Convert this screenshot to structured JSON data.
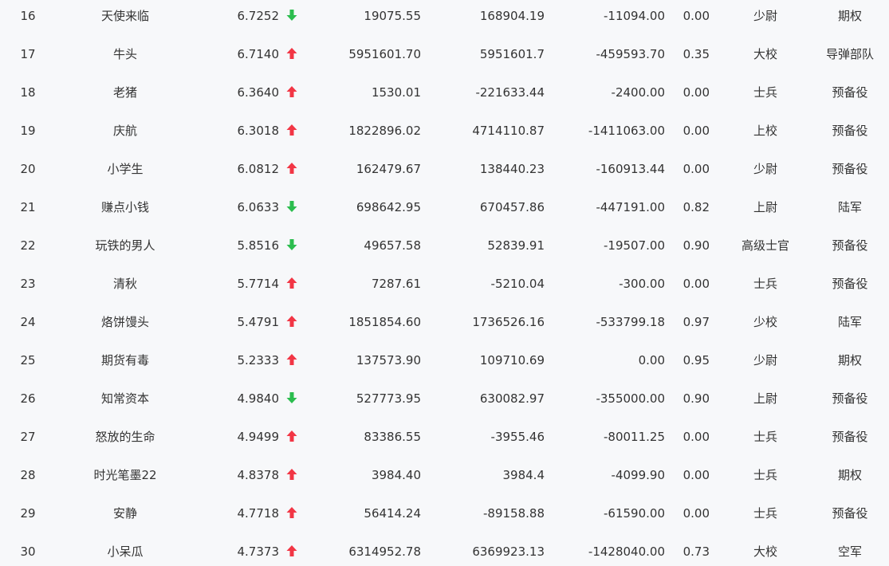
{
  "colors": {
    "up": "#f23645",
    "down": "#2bbd4e",
    "text": "#333333",
    "background": "#f7f8fa"
  },
  "rows": [
    {
      "rank": "16",
      "name": "天使来临",
      "score": "6.7252",
      "trend": "down",
      "a": "19075.55",
      "b": "168904.19",
      "c": "-11094.00",
      "d": "0.00",
      "title": "少尉",
      "branch": "期权"
    },
    {
      "rank": "17",
      "name": "牛头",
      "score": "6.7140",
      "trend": "up",
      "a": "5951601.70",
      "b": "5951601.7",
      "c": "-459593.70",
      "d": "0.35",
      "title": "大校",
      "branch": "导弹部队"
    },
    {
      "rank": "18",
      "name": "老猪",
      "score": "6.3640",
      "trend": "up",
      "a": "1530.01",
      "b": "-221633.44",
      "c": "-2400.00",
      "d": "0.00",
      "title": "士兵",
      "branch": "预备役"
    },
    {
      "rank": "19",
      "name": "庆航",
      "score": "6.3018",
      "trend": "up",
      "a": "1822896.02",
      "b": "4714110.87",
      "c": "-1411063.00",
      "d": "0.00",
      "title": "上校",
      "branch": "预备役"
    },
    {
      "rank": "20",
      "name": "小学生",
      "score": "6.0812",
      "trend": "up",
      "a": "162479.67",
      "b": "138440.23",
      "c": "-160913.44",
      "d": "0.00",
      "title": "少尉",
      "branch": "预备役"
    },
    {
      "rank": "21",
      "name": "赚点小钱",
      "score": "6.0633",
      "trend": "down",
      "a": "698642.95",
      "b": "670457.86",
      "c": "-447191.00",
      "d": "0.82",
      "title": "上尉",
      "branch": "陆军"
    },
    {
      "rank": "22",
      "name": "玩铁的男人",
      "score": "5.8516",
      "trend": "down",
      "a": "49657.58",
      "b": "52839.91",
      "c": "-19507.00",
      "d": "0.90",
      "title": "高级士官",
      "branch": "预备役"
    },
    {
      "rank": "23",
      "name": "清秋",
      "score": "5.7714",
      "trend": "up",
      "a": "7287.61",
      "b": "-5210.04",
      "c": "-300.00",
      "d": "0.00",
      "title": "士兵",
      "branch": "预备役"
    },
    {
      "rank": "24",
      "name": "烙饼馒头",
      "score": "5.4791",
      "trend": "up",
      "a": "1851854.60",
      "b": "1736526.16",
      "c": "-533799.18",
      "d": "0.97",
      "title": "少校",
      "branch": "陆军"
    },
    {
      "rank": "25",
      "name": "期货有毒",
      "score": "5.2333",
      "trend": "up",
      "a": "137573.90",
      "b": "109710.69",
      "c": "0.00",
      "d": "0.95",
      "title": "少尉",
      "branch": "期权"
    },
    {
      "rank": "26",
      "name": "知常资本",
      "score": "4.9840",
      "trend": "down",
      "a": "527773.95",
      "b": "630082.97",
      "c": "-355000.00",
      "d": "0.90",
      "title": "上尉",
      "branch": "预备役"
    },
    {
      "rank": "27",
      "name": "怒放的生命",
      "score": "4.9499",
      "trend": "up",
      "a": "83386.55",
      "b": "-3955.46",
      "c": "-80011.25",
      "d": "0.00",
      "title": "士兵",
      "branch": "预备役"
    },
    {
      "rank": "28",
      "name": "时光笔墨22",
      "score": "4.8378",
      "trend": "up",
      "a": "3984.40",
      "b": "3984.4",
      "c": "-4099.90",
      "d": "0.00",
      "title": "士兵",
      "branch": "期权"
    },
    {
      "rank": "29",
      "name": "安静",
      "score": "4.7718",
      "trend": "up",
      "a": "56414.24",
      "b": "-89158.88",
      "c": "-61590.00",
      "d": "0.00",
      "title": "士兵",
      "branch": "预备役"
    },
    {
      "rank": "30",
      "name": "小呆瓜",
      "score": "4.7373",
      "trend": "up",
      "a": "6314952.78",
      "b": "6369923.13",
      "c": "-1428040.00",
      "d": "0.73",
      "title": "大校",
      "branch": "空军"
    }
  ]
}
